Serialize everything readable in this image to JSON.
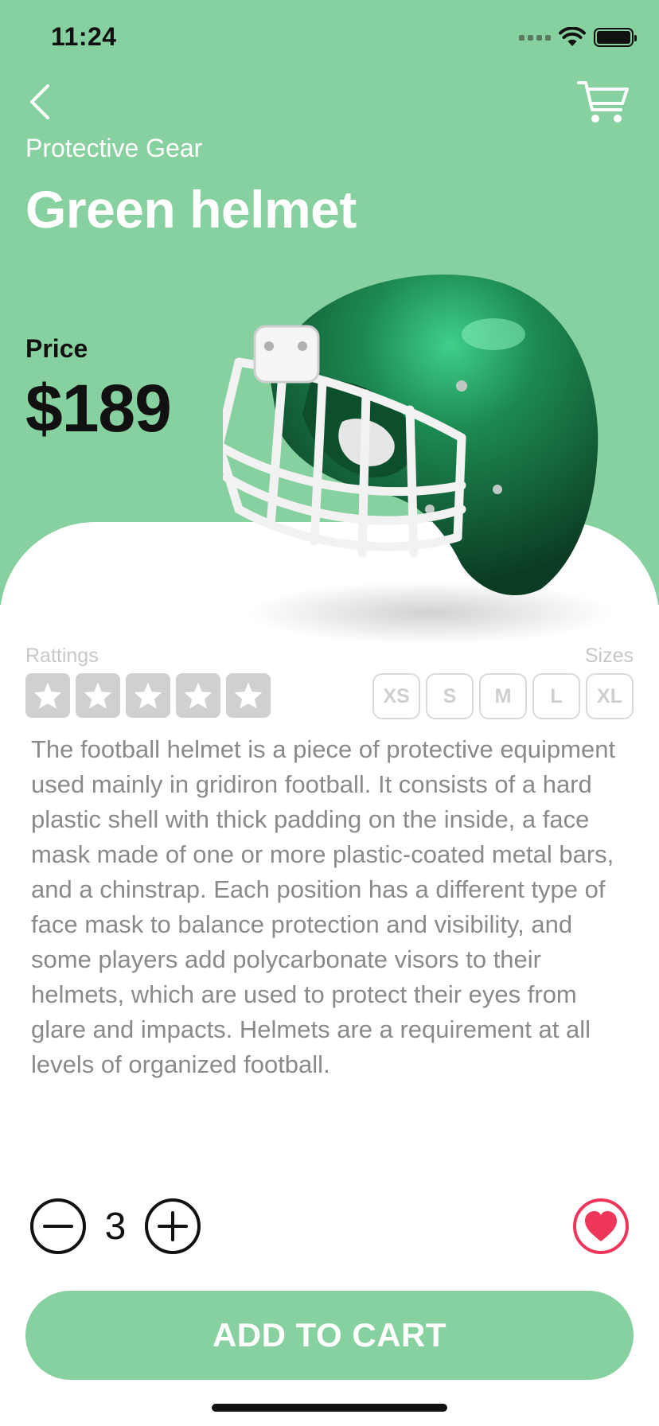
{
  "status_bar": {
    "time": "11:24"
  },
  "header": {
    "category": "Protective Gear",
    "title": "Green helmet"
  },
  "price": {
    "label": "Price",
    "value": "$189"
  },
  "product_image": "green-football-helmet",
  "ratings": {
    "label": "Rattings",
    "stars_total": 5,
    "stars_filled": 0
  },
  "sizes": {
    "label": "Sizes",
    "options": [
      "XS",
      "S",
      "M",
      "L",
      "XL"
    ]
  },
  "description": "The football helmet is a piece of protective equipment used mainly in gridiron football. It consists of a hard plastic shell with thick padding on the inside, a face mask made of one or more plastic-coated metal bars, and a chinstrap. Each position has a different type of face mask to balance protection and visibility, and some players add polycarbonate visors to their helmets, which are used to protect their eyes from glare and impacts. Helmets are a requirement at all levels of organized football.",
  "quantity": {
    "value": "3"
  },
  "actions": {
    "add_to_cart": "ADD TO CART"
  },
  "colors": {
    "accent": "#87d09f",
    "heart": "#f0355b",
    "text": "#111111",
    "muted": "#8a8a8a"
  },
  "icons": {
    "back": "chevron-left-icon",
    "cart": "cart-icon",
    "minus": "minus-circle-icon",
    "plus": "plus-circle-icon",
    "favorite": "heart-icon",
    "star": "star-icon"
  }
}
